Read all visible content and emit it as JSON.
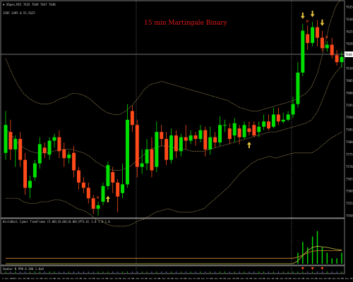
{
  "terminal": {
    "symbol_header": "▼ XOpen,M15 7635 7649 7647 7648",
    "corner_readout": "1585 1495 0.55,5625",
    "chart_title": "15 min Martingale Binary",
    "indicator1_label": "HistoBarL Cymer TimeFrame (5.00)(0.00)(0.00)(PT3.0) 1.0 1.0 1.0",
    "indicator2_label": "Smabar N PPN 0.380 1.0x0"
  },
  "colors": {
    "background": "#000000",
    "bull": "#00e000",
    "bear": "#ff4a1a",
    "band": "#c8b06a",
    "arrow": "#e6c440",
    "grid_line": "#808080",
    "panel_border": "#9a9a9a",
    "title": "#e01b1b"
  },
  "price_axis_labels": [
    "7635",
    "7630",
    "7625",
    "7620",
    "7615",
    "7610",
    "7605",
    "7600",
    "7595",
    "7590",
    "7585",
    "7580",
    "7575",
    "7570",
    "7565",
    "7560",
    "7555",
    "7550"
  ],
  "current_price_label": "7648",
  "time_axis_labels": [
    "2 Jan 2020",
    "2 Jan 10:45",
    "2 Jan 11:15",
    "2 Jan 11:45",
    "2 Jan 12:15",
    "2 Jan 12:45",
    "2 Jan 13:15",
    "2 Jan 13:45",
    "2 Jan 14:15",
    "2 Jan 14:45",
    "2 Jan 15:15",
    "2 Jan 15:45",
    "2 Jan 16:15",
    "2 Jan 16:45",
    "2 Jan 17:15",
    "2 Jan 17:45",
    "2 Jan 18:15",
    "2 Jan 18:45",
    "2 Jan 19:15",
    "2 Jan 19:45",
    "2 Jan 20:15",
    "2 Jan 20:45",
    "2 Jan 21:15",
    "2 Jan 21:45",
    "2 Jan 22:15",
    "2 Jan 22:45",
    "3 Jan 00:15"
  ],
  "w_markers": [
    "W",
    "W",
    "W"
  ],
  "chart_data": {
    "type": "candlestick",
    "candles": [
      {
        "o": 7566,
        "c": 7582,
        "h": 7590,
        "l": 7562
      },
      {
        "o": 7578,
        "c": 7568,
        "h": 7585,
        "l": 7562
      },
      {
        "o": 7568,
        "c": 7574,
        "h": 7576,
        "l": 7558
      },
      {
        "o": 7574,
        "c": 7562,
        "h": 7578,
        "l": 7558
      },
      {
        "o": 7562,
        "c": 7546,
        "h": 7566,
        "l": 7542
      },
      {
        "o": 7546,
        "c": 7550,
        "h": 7553,
        "l": 7540
      },
      {
        "o": 7552,
        "c": 7560,
        "h": 7562,
        "l": 7550
      },
      {
        "o": 7560,
        "c": 7571,
        "h": 7575,
        "l": 7557
      },
      {
        "o": 7569,
        "c": 7566,
        "h": 7572,
        "l": 7563
      },
      {
        "o": 7565,
        "c": 7573,
        "h": 7575,
        "l": 7562
      },
      {
        "o": 7573,
        "c": 7575,
        "h": 7577,
        "l": 7569
      },
      {
        "o": 7575,
        "c": 7567,
        "h": 7579,
        "l": 7563
      },
      {
        "o": 7568,
        "c": 7563,
        "h": 7572,
        "l": 7558
      },
      {
        "o": 7563,
        "c": 7565,
        "h": 7567,
        "l": 7560
      },
      {
        "o": 7566,
        "c": 7556,
        "h": 7570,
        "l": 7552
      },
      {
        "o": 7556,
        "c": 7549,
        "h": 7558,
        "l": 7545
      },
      {
        "o": 7549,
        "c": 7546,
        "h": 7552,
        "l": 7543
      },
      {
        "o": 7546,
        "c": 7540,
        "h": 7549,
        "l": 7537
      },
      {
        "o": 7540,
        "c": 7534,
        "h": 7542,
        "l": 7531
      },
      {
        "o": 7534,
        "c": 7536,
        "h": 7538,
        "l": 7530
      },
      {
        "o": 7538,
        "c": 7547,
        "h": 7549,
        "l": 7536
      },
      {
        "o": 7547,
        "c": 7559,
        "h": 7561,
        "l": 7545
      },
      {
        "o": 7555,
        "c": 7549,
        "h": 7558,
        "l": 7543
      },
      {
        "o": 7549,
        "c": 7541,
        "h": 7551,
        "l": 7532
      },
      {
        "o": 7543,
        "c": 7548,
        "h": 7560,
        "l": 7540
      },
      {
        "o": 7548,
        "c": 7585,
        "h": 7594,
        "l": 7546
      },
      {
        "o": 7590,
        "c": 7582,
        "h": 7593,
        "l": 7578
      },
      {
        "o": 7582,
        "c": 7558,
        "h": 7585,
        "l": 7552
      },
      {
        "o": 7558,
        "c": 7560,
        "h": 7568,
        "l": 7554
      },
      {
        "o": 7560,
        "c": 7568,
        "h": 7574,
        "l": 7556
      },
      {
        "o": 7568,
        "c": 7556,
        "h": 7575,
        "l": 7552
      },
      {
        "o": 7558,
        "c": 7578,
        "h": 7584,
        "l": 7555
      },
      {
        "o": 7578,
        "c": 7574,
        "h": 7582,
        "l": 7570
      },
      {
        "o": 7574,
        "c": 7562,
        "h": 7578,
        "l": 7559
      },
      {
        "o": 7562,
        "c": 7576,
        "h": 7580,
        "l": 7560
      },
      {
        "o": 7576,
        "c": 7567,
        "h": 7579,
        "l": 7563
      },
      {
        "o": 7567,
        "c": 7575,
        "h": 7577,
        "l": 7564
      },
      {
        "o": 7575,
        "c": 7573,
        "h": 7582,
        "l": 7568
      },
      {
        "o": 7573,
        "c": 7576,
        "h": 7579,
        "l": 7571
      },
      {
        "o": 7576,
        "c": 7574,
        "h": 7578,
        "l": 7570
      },
      {
        "o": 7574,
        "c": 7579,
        "h": 7582,
        "l": 7572
      },
      {
        "o": 7579,
        "c": 7568,
        "h": 7581,
        "l": 7564
      },
      {
        "o": 7568,
        "c": 7575,
        "h": 7581,
        "l": 7565
      },
      {
        "o": 7575,
        "c": 7572,
        "h": 7578,
        "l": 7569
      },
      {
        "o": 7572,
        "c": 7582,
        "h": 7587,
        "l": 7570
      },
      {
        "o": 7582,
        "c": 7582,
        "h": 7585,
        "l": 7578
      },
      {
        "o": 7580,
        "c": 7574,
        "h": 7583,
        "l": 7571
      },
      {
        "o": 7576,
        "c": 7583,
        "h": 7586,
        "l": 7572
      },
      {
        "o": 7580,
        "c": 7575,
        "h": 7582,
        "l": 7571
      },
      {
        "o": 7575,
        "c": 7582,
        "h": 7584,
        "l": 7574
      },
      {
        "o": 7580,
        "c": 7578,
        "h": 7584,
        "l": 7576
      },
      {
        "o": 7582,
        "c": 7576,
        "h": 7584,
        "l": 7575
      },
      {
        "o": 7578,
        "c": 7581,
        "h": 7584,
        "l": 7575
      },
      {
        "o": 7581,
        "c": 7584,
        "h": 7588,
        "l": 7579
      },
      {
        "o": 7584,
        "c": 7580,
        "h": 7588,
        "l": 7579
      },
      {
        "o": 7581,
        "c": 7588,
        "h": 7592,
        "l": 7580
      },
      {
        "o": 7588,
        "c": 7584,
        "h": 7592,
        "l": 7582
      },
      {
        "o": 7584,
        "c": 7585,
        "h": 7589,
        "l": 7583
      },
      {
        "o": 7585,
        "c": 7588,
        "h": 7590,
        "l": 7584
      },
      {
        "o": 7588,
        "c": 7594,
        "h": 7598,
        "l": 7586
      },
      {
        "o": 7594,
        "c": 7612,
        "h": 7618,
        "l": 7592
      },
      {
        "o": 7612,
        "c": 7636,
        "h": 7640,
        "l": 7610
      },
      {
        "o": 7634,
        "c": 7629,
        "h": 7639,
        "l": 7625
      },
      {
        "o": 7629,
        "c": 7638,
        "h": 7641,
        "l": 7627
      },
      {
        "o": 7638,
        "c": 7632,
        "h": 7642,
        "l": 7627
      },
      {
        "o": 7632,
        "c": 7626,
        "h": 7636,
        "l": 7624
      },
      {
        "o": 7626,
        "c": 7628,
        "h": 7630,
        "l": 7624
      },
      {
        "o": 7628,
        "c": 7622,
        "h": 7632,
        "l": 7620
      },
      {
        "o": 7622,
        "c": 7618,
        "h": 7625,
        "l": 7616
      },
      {
        "o": 7618,
        "c": 7621,
        "h": 7624,
        "l": 7615
      }
    ],
    "upper_band": [
      7620,
      7612,
      7605,
      7600,
      7597,
      7595,
      7594,
      7594,
      7595,
      7597,
      7598,
      7600,
      7600,
      7599,
      7597,
      7594,
      7591,
      7589,
      7588,
      7588,
      7590,
      7593,
      7597,
      7602,
      7605,
      7606,
      7607,
      7606,
      7605,
      7604,
      7603,
      7602,
      7601,
      7600,
      7599,
      7598,
      7597,
      7596,
      7594,
      7592,
      7591,
      7590,
      7590,
      7591,
      7592,
      7593,
      7594,
      7595,
      7596,
      7598,
      7600,
      7604,
      7612,
      7625,
      7640,
      7650,
      7655
    ],
    "mid_band": [
      7580,
      7576,
      7572,
      7569,
      7567,
      7566,
      7566,
      7566,
      7567,
      7568,
      7568,
      7568,
      7567,
      7566,
      7564,
      7561,
      7559,
      7557,
      7556,
      7556,
      7557,
      7559,
      7562,
      7565,
      7568,
      7569,
      7570,
      7570,
      7569,
      7568,
      7568,
      7567,
      7567,
      7567,
      7568,
      7569,
      7570,
      7571,
      7572,
      7573,
      7574,
      7575,
      7576,
      7577,
      7578,
      7578,
      7579,
      7580,
      7581,
      7582,
      7583,
      7585,
      7590,
      7598,
      7607,
      7612,
      7616
    ],
    "lower_band": [
      7540,
      7540,
      7540,
      7538,
      7537,
      7537,
      7538,
      7538,
      7539,
      7539,
      7538,
      7536,
      7534,
      7533,
      7531,
      7528,
      7527,
      7525,
      7524,
      7524,
      7524,
      7525,
      7527,
      7528,
      7530,
      7532,
      7533,
      7534,
      7533,
      7532,
      7532,
      7532,
      7533,
      7534,
      7537,
      7540,
      7543,
      7546,
      7550,
      7554,
      7557,
      7560,
      7562,
      7563,
      7564,
      7563,
      7564,
      7565,
      7566,
      7566,
      7566,
      7566,
      7568,
      7571,
      7574,
      7576,
      7578
    ],
    "up_arrow_candles": [
      21,
      50
    ],
    "down_arrow_candles": [
      61,
      63,
      65
    ],
    "w_marker_candles": [
      19,
      62,
      66
    ],
    "histogram": [
      0,
      0,
      0,
      0,
      0,
      0,
      0,
      0,
      0,
      0,
      0,
      0,
      0,
      0,
      0,
      0,
      0,
      0,
      0,
      0,
      0,
      0,
      0,
      0,
      0,
      0,
      0,
      0,
      0,
      0,
      0,
      0,
      0,
      0,
      0,
      0,
      0,
      0,
      0,
      0,
      0,
      0,
      0,
      0,
      0,
      0,
      0,
      0,
      0,
      0,
      0,
      0,
      0,
      0,
      0,
      0,
      0,
      0,
      0,
      0,
      2,
      4,
      3,
      5,
      6,
      3,
      2,
      1,
      1,
      2
    ],
    "histogram_signal": [
      0,
      0,
      0,
      0,
      0,
      0,
      0,
      0,
      0,
      0,
      0,
      0,
      0,
      0,
      0,
      0,
      0,
      0,
      0,
      0,
      0,
      0,
      0,
      0,
      0,
      0,
      0,
      0,
      0,
      0,
      0,
      0,
      0,
      0,
      0,
      0,
      0,
      0,
      0,
      0,
      0,
      0,
      0,
      0,
      0,
      0,
      0,
      0,
      0,
      0,
      0,
      0,
      0,
      0,
      0,
      0,
      0,
      0,
      0,
      0,
      0.5,
      1.5,
      2.4,
      3.0,
      3.2,
      3.1,
      3.0,
      2.8,
      2.6,
      2.5
    ],
    "histogram_baseline": [
      1.0,
      1.0,
      1.0,
      1.0,
      1.0,
      1.0,
      1.0,
      1.0,
      1.0,
      1.0,
      1.0,
      1.0,
      1.0,
      1.0,
      1.0,
      1.0,
      1.0,
      1.0,
      1.0,
      1.0,
      1.0,
      1.0,
      1.0,
      1.0,
      1.0,
      1.0,
      1.0,
      1.0,
      1.0,
      1.0,
      1.0,
      1.0,
      1.0,
      1.0,
      1.0,
      1.0,
      1.0,
      1.0,
      1.0,
      1.0,
      1.0,
      1.0,
      1.0,
      1.0,
      1.0,
      1.0,
      1.0,
      1.0,
      1.0,
      1.0,
      1.0,
      1.0,
      1.0,
      1.0,
      1.0,
      1.0,
      1.0,
      1.0,
      1.0,
      1.0,
      1.2,
      1.6,
      2.0,
      2.3,
      2.4,
      2.4,
      2.4,
      2.4,
      2.4,
      2.4
    ]
  }
}
